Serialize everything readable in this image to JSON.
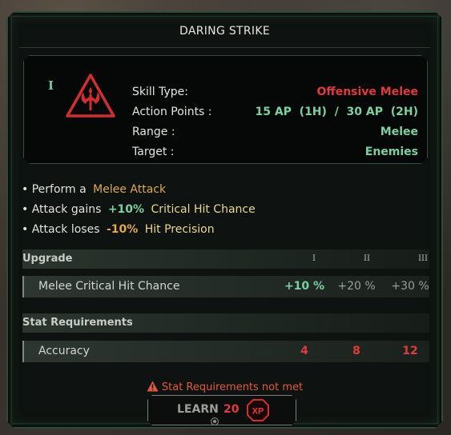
{
  "title": "DARING STRIKE",
  "rank_glyph": "I",
  "skill_icon": "melee-axe-icon",
  "properties": [
    {
      "label": "Skill Type:",
      "value": "Offensive Melee",
      "color": "#e03b3b"
    },
    {
      "label": "Action Points :",
      "value": "15 AP  (1H)  /  30 AP  (2H)",
      "color": "#7ccfa0"
    },
    {
      "label": "Range :",
      "value": "Melee",
      "color": "#7ccfa0"
    },
    {
      "label": "Target :",
      "value": "Enemies",
      "color": "#7ccfa0"
    }
  ],
  "effects": [
    {
      "prefix": "• Perform a",
      "amount": "",
      "term": "Melee Attack"
    },
    {
      "prefix": "• Attack gains",
      "amount": "+10%",
      "term": "Critical Hit Chance"
    },
    {
      "prefix": "• Attack loses",
      "amount": "-10%",
      "term": "Hit Precision"
    }
  ],
  "upgrade": {
    "header": "Upgrade",
    "tiers": [
      "I",
      "II",
      "III"
    ],
    "row_label": "Melee Critical Hit Chance",
    "values": [
      "+10 %",
      "+20 %",
      "+30 %"
    ]
  },
  "stat_requirements": {
    "header": "Stat Requirements",
    "row_label": "Accuracy",
    "values": [
      "4",
      "8",
      "12"
    ]
  },
  "warning": "Stat Requirements not met",
  "learn": {
    "label": "LEARN",
    "cost": "20",
    "currency": "XP"
  },
  "colors": {
    "accent_green": "#7ccfa0",
    "accent_red": "#e03b3b",
    "warning": "#e05a3e",
    "panel_border": "#2f4a38"
  }
}
